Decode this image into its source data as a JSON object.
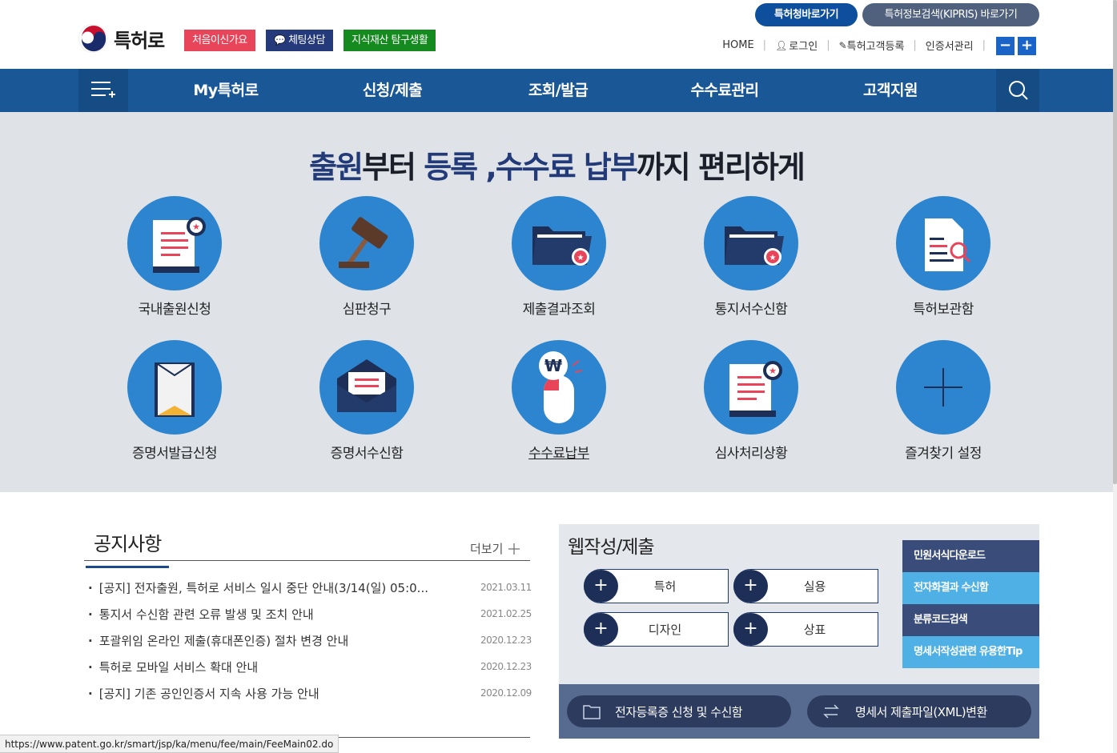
{
  "header": {
    "logo_text": "특허로",
    "quick_buttons": [
      "처음이신가요",
      "체팅상담",
      "지식재산 탐구생활"
    ],
    "pills": [
      "특허청바로가기",
      "특허정보검색(KIPRIS) 바로가기"
    ],
    "util_links": [
      "HOME",
      "로그인",
      "특허고객등록",
      "인증서관리"
    ],
    "zoom": [
      "−",
      "+"
    ]
  },
  "nav": {
    "items": [
      "My특허로",
      "신청/제출",
      "조회/발급",
      "수수료관리",
      "고객지원"
    ]
  },
  "hero": {
    "title_parts": [
      "출원",
      "부터 ",
      "등록",
      " ,",
      "수수료 납부",
      "까지 편리하게"
    ],
    "services": [
      {
        "label": "국내출원신청",
        "icon": "application-document-icon"
      },
      {
        "label": "심판청구",
        "icon": "gavel-icon"
      },
      {
        "label": "제출결과조회",
        "icon": "folder-result-icon"
      },
      {
        "label": "통지서수신함",
        "icon": "folder-notice-icon"
      },
      {
        "label": "특허보관함",
        "icon": "document-search-icon"
      },
      {
        "label": "증명서발급신청",
        "icon": "certificate-envelope-icon"
      },
      {
        "label": "증명서수신함",
        "icon": "mail-envelope-icon"
      },
      {
        "label": "수수료납부",
        "icon": "fee-mouse-icon"
      },
      {
        "label": "심사처리상황",
        "icon": "review-document-icon"
      },
      {
        "label": "즐겨찾기 설정",
        "icon": "plus-icon"
      }
    ]
  },
  "notice": {
    "title": "공지사항",
    "more": "더보기",
    "items": [
      {
        "title": "[공지] 전자출원, 특허로 서비스 일시 중단 안내(3/14(일) 05:0...",
        "date": "2021.03.11"
      },
      {
        "title": "통지서 수신함 관련 오류 발생 및 조치 안내",
        "date": "2021.02.25"
      },
      {
        "title": "포괄위임 온라인 제출(휴대폰인증) 절차 변경 안내",
        "date": "2020.12.23"
      },
      {
        "title": "특허로 모바일 서비스 확대 안내",
        "date": "2020.12.23"
      },
      {
        "title": "[공지] 기존 공인인증서 지속 사용 가능 안내",
        "date": "2020.12.09"
      }
    ]
  },
  "web": {
    "title": "웹작성/제출",
    "buttons": [
      "특허",
      "실용",
      "디자인",
      "상표"
    ],
    "side_links": [
      "민원서식다운로드",
      "전자화결과 수신함",
      "분류코드검색",
      "명세서작성관련 유용한Tip"
    ],
    "bar_buttons": [
      "전자등록증 신청 및 수신함",
      "명세서 제출파일(XML)변환"
    ]
  },
  "status_url": "https://www.patent.go.kr/smart/jsp/ka/menu/fee/main/FeeMain02.do",
  "colors": {
    "nav": "#1a5796",
    "accent": "#2d84cf",
    "hero_bg": "#dfe3e8"
  }
}
